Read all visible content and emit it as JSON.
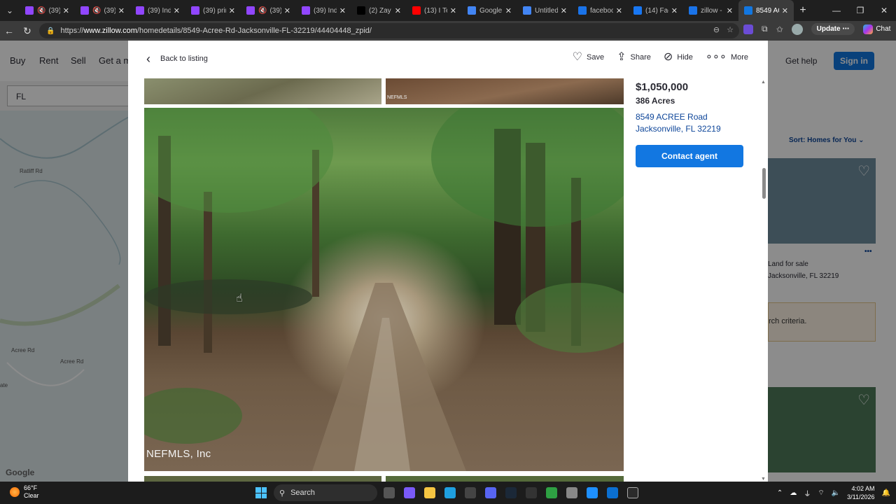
{
  "browser": {
    "tabs": [
      {
        "title": "(39) I",
        "fav": "#9146ff",
        "muted": true
      },
      {
        "title": "(39) I",
        "fav": "#9146ff",
        "muted": true
      },
      {
        "title": "(39) Indi",
        "fav": "#9146ff",
        "muted": false
      },
      {
        "title": "(39) prin",
        "fav": "#9146ff",
        "muted": false
      },
      {
        "title": "(39) I",
        "fav": "#9146ff",
        "muted": true
      },
      {
        "title": "(39) Indi",
        "fav": "#9146ff",
        "muted": false
      },
      {
        "title": "(2) Zay C",
        "fav": "#000000",
        "muted": false
      },
      {
        "title": "(13) I Tes",
        "fav": "#ff0000",
        "muted": false
      },
      {
        "title": "Google D",
        "fav": "#4285f4",
        "muted": false
      },
      {
        "title": "Untitled",
        "fav": "#4285f4",
        "muted": false
      },
      {
        "title": "faceboo",
        "fav": "#1a73e8",
        "muted": false
      },
      {
        "title": "(14) Face",
        "fav": "#1877f2",
        "muted": false
      },
      {
        "title": "zillow - S",
        "fav": "#1a73e8",
        "muted": false
      },
      {
        "title": "8549 ACI",
        "fav": "#1277e1",
        "muted": false
      }
    ],
    "url_prefix": "https://",
    "url_host": "www.zillow.com",
    "url_path": "/homedetails/8549-Acree-Rd-Jacksonville-FL-32219/44404448_zpid/",
    "update_label": "Update",
    "chat_label": "Chat"
  },
  "bg": {
    "nav": [
      "Buy",
      "Rent",
      "Sell",
      "Get a m"
    ],
    "search_value": "FL",
    "map_roads": [
      "Ratliff Rd",
      "Acree Rd",
      "Acree Rd"
    ],
    "map_edge_text": "ate",
    "google_logo": "Google",
    "get_help": "Get help",
    "sign_in": "Sign in",
    "sort_label": "Sort: Homes for You",
    "card_type": "Land for sale",
    "card_address": "Jacksonville, FL 32219",
    "banner_text": "rch criteria."
  },
  "modal": {
    "back_label": "Back to listing",
    "actions": {
      "save": "Save",
      "share": "Share",
      "hide": "Hide",
      "more": "More"
    },
    "thumb_tag": "NEFMLS",
    "watermark": "NEFMLS, Inc",
    "price": "$1,050,000",
    "acres": "386 Acres",
    "address_line1": "8549 ACREE Road",
    "address_line2": "Jacksonville, FL 32219",
    "contact_label": "Contact agent"
  },
  "taskbar": {
    "temp": "66°F",
    "condition": "Clear",
    "search_label": "Search",
    "time": "4:02 AM",
    "date": "3/11/2026"
  }
}
